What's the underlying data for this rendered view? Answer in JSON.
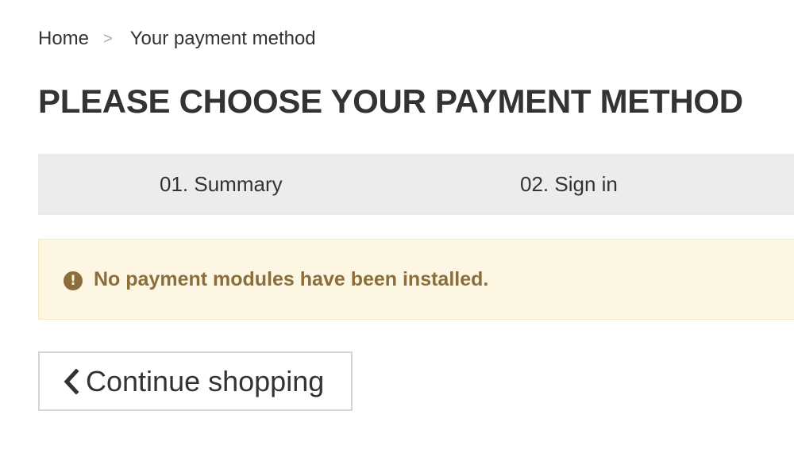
{
  "breadcrumb": {
    "home_label": "Home",
    "separator": ">",
    "current_label": "Your payment method"
  },
  "page_title": "PLEASE CHOOSE YOUR PAYMENT METHOD",
  "steps": [
    {
      "label": "01. Summary"
    },
    {
      "label": "02. Sign in"
    }
  ],
  "alert": {
    "icon": "exclamation-circle-icon",
    "icon_glyph": "!",
    "message": "No payment modules have been installed.",
    "text_color": "#8c6e3c",
    "background_color": "#fcf6e3"
  },
  "continue_button": {
    "icon": "chevron-left-icon",
    "label": "Continue shopping"
  }
}
